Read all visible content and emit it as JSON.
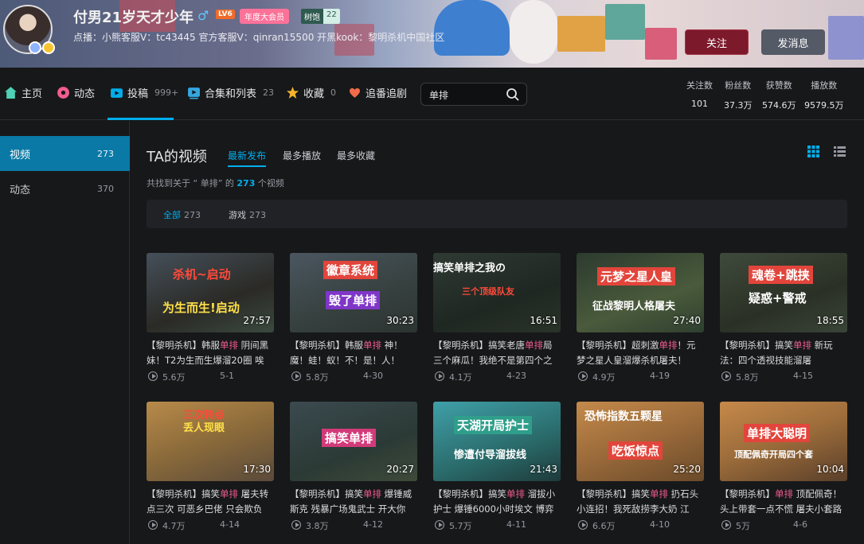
{
  "profile": {
    "name": "付男21岁天才少年",
    "gender_symbol": "♂",
    "level": "LV6",
    "vip_label": "年度大会员",
    "fan_badge_name": "树饱",
    "fan_badge_level": "22",
    "signature": "点播：小熊客服V：tc43445 官方客服V：qinran15500 开黑kook：黎明杀机中国社区",
    "follow_label": "关注",
    "message_label": "发消息"
  },
  "nav": {
    "items": [
      {
        "label": "主页",
        "count": ""
      },
      {
        "label": "动态",
        "count": ""
      },
      {
        "label": "投稿",
        "count": "999+"
      },
      {
        "label": "合集和列表",
        "count": "23"
      },
      {
        "label": "收藏",
        "count": "0"
      },
      {
        "label": "追番追剧",
        "count": ""
      }
    ],
    "search_value": "单排",
    "stats": [
      {
        "label": "关注数",
        "value": "101"
      },
      {
        "label": "粉丝数",
        "value": "37.3万"
      },
      {
        "label": "获赞数",
        "value": "574.6万"
      },
      {
        "label": "播放数",
        "value": "9579.5万"
      }
    ]
  },
  "sidebar": {
    "items": [
      {
        "label": "视频",
        "count": "273"
      },
      {
        "label": "动态",
        "count": "370"
      }
    ]
  },
  "main": {
    "title": "TA的视频",
    "sort_tabs": [
      "最新发布",
      "最多播放",
      "最多收藏"
    ],
    "found_prefix": "共找到关于 “ 单排” 的",
    "found_count": "273",
    "found_suffix": "个视频",
    "filters": [
      {
        "label": "全部",
        "count": "273"
      },
      {
        "label": "游戏",
        "count": "273"
      }
    ]
  },
  "videos": [
    {
      "cap1": "杀机~启动",
      "cap2": "为生而生!启动",
      "duration": "27:57",
      "t_pre": "【黎明杀机】韩服",
      "t_hl": "单排",
      "t_post": " 阴间黑妹！T2为生而生爆溜20圈 唉",
      "views": "5.6万",
      "date": "5-1"
    },
    {
      "cap1": "徽章系统",
      "cap2": "毁了单排",
      "duration": "30:23",
      "t_pre": "【黎明杀机】韩服",
      "t_hl": "单排",
      "t_post": " 神！魔！蛙！蚁！不！是！人！",
      "views": "5.8万",
      "date": "4-30"
    },
    {
      "cap1": "搞笑单排之我の",
      "cap2": "三个顶级队友",
      "duration": "16:51",
      "t_pre": "【黎明杀机】搞笑老唐",
      "t_hl": "单排",
      "t_post": "局 三个麻瓜！我绝不是第四个之",
      "views": "4.1万",
      "date": "4-23"
    },
    {
      "cap1": "元梦之星人皇",
      "cap2": "征战黎明人格屠夫",
      "duration": "27:40",
      "t_pre": "【黎明杀机】超刺激",
      "t_hl": "单排",
      "t_post": "！元梦之星人皇溜爆杀机屠夫！",
      "views": "4.9万",
      "date": "4-19"
    },
    {
      "cap1": "魂卷+跳挟",
      "cap2": "疑惑+警戒",
      "duration": "18:55",
      "t_pre": "【黎明杀机】搞笑",
      "t_hl": "单排",
      "t_post": " 新玩法：四个透视技能溜屠",
      "views": "5.8万",
      "date": "4-15"
    },
    {
      "cap1": "三次转点",
      "cap2": "丢人现眼",
      "duration": "17:30",
      "t_pre": "【黎明杀机】搞笑",
      "t_hl": "单排",
      "t_post": " 屠夫转点三次 可恶乡巴佬 只会欺负",
      "views": "4.7万",
      "date": "4-14"
    },
    {
      "cap1": "搞笑单排",
      "cap2": "",
      "duration": "20:27",
      "t_pre": "【黎明杀机】搞笑",
      "t_hl": "单排",
      "t_post": " 爆锤威斯克 残暴广场鬼武士 开大你",
      "views": "3.8万",
      "date": "4-12"
    },
    {
      "cap1": "天湖开局护士",
      "cap2": "惨遭付导溜拔线",
      "duration": "21:43",
      "t_pre": "【黎明杀机】搞笑",
      "t_hl": "单排",
      "t_post": " 溜拔小护士 爆锤6000小时埃文 博弈",
      "views": "5.7万",
      "date": "4-11"
    },
    {
      "cap1": "恐怖指数五颗星",
      "cap2": "吃饭惊点",
      "duration": "25:20",
      "t_pre": "【黎明杀机】搞笑",
      "t_hl": "单排",
      "t_post": " 扔石头小连招！我死敌捞李大奶 江",
      "views": "6.6万",
      "date": "4-10"
    },
    {
      "cap1": "单排大聪明",
      "cap2": "顶配佩奇开局四个套",
      "duration": "10:04",
      "t_pre": "【黎明杀机】",
      "t_hl": "单排",
      "t_post": " 顶配佩奇！头上带套一点不慌 屠夫小套路",
      "views": "5万",
      "date": "4-6"
    }
  ],
  "colors": {
    "accent": "#00aeec",
    "highlight": "#f25d8e",
    "follow_bg": "#7c1a2c"
  }
}
